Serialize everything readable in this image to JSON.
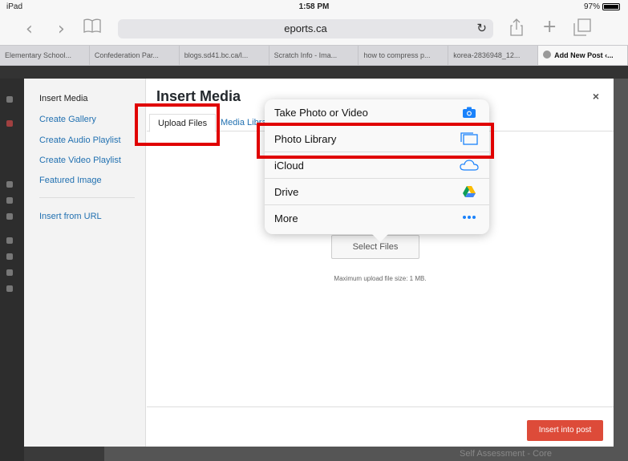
{
  "status": {
    "device": "iPad",
    "time": "1:58 PM",
    "battery": "97%"
  },
  "toolbar": {
    "url": "eports.ca"
  },
  "tabs": [
    "Elementary School...",
    "Confederation Par...",
    "blogs.sd41.bc.ca/l...",
    "Scratch Info - Ima...",
    "how to compress p...",
    "korea-2836948_12...",
    "Add New Post ‹..."
  ],
  "modal": {
    "title": "Insert Media",
    "close": "×",
    "menu": {
      "title": "Insert Media",
      "items": [
        "Create Gallery",
        "Create Audio Playlist",
        "Create Video Playlist",
        "Featured Image"
      ],
      "url_item": "Insert from URL"
    },
    "tabs": {
      "upload": "Upload Files",
      "library": "Media Library"
    },
    "select_button": "Select Files",
    "max_size": "Maximum upload file size: 1 MB.",
    "insert_button": "Insert into post"
  },
  "popover": {
    "items": [
      {
        "label": "Take Photo or Video",
        "icon": "camera-icon"
      },
      {
        "label": "Photo Library",
        "icon": "photo-library-icon"
      },
      {
        "label": "iCloud",
        "icon": "cloud-icon"
      },
      {
        "label": "Drive",
        "icon": "drive-icon"
      },
      {
        "label": "More",
        "icon": "more-icon"
      }
    ]
  },
  "background": {
    "bottom_text": "Self Assessment - Core"
  },
  "colors": {
    "accent_blue": "#2271b1",
    "insert_red": "#dd4b39",
    "highlight_red": "#e00000",
    "ios_blue": "#1a82fb"
  }
}
